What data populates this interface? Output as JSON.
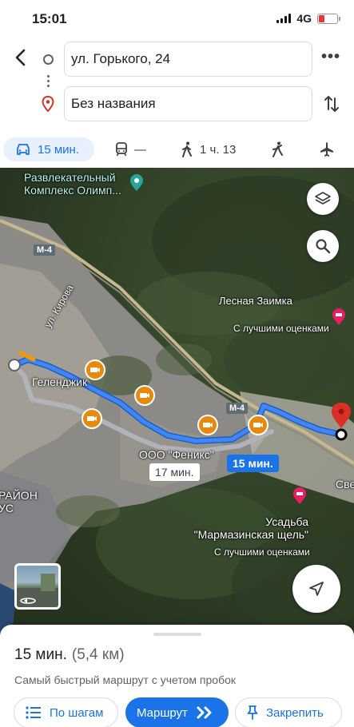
{
  "status_bar": {
    "time": "15:01",
    "network": "4G",
    "battery_color": "#e53935"
  },
  "route_inputs": {
    "back_icon": "back-arrow-icon",
    "origin": "ул. Горького, 24",
    "destination": "Без названия",
    "more_icon": "more-icon",
    "swap_icon": "swap-icon"
  },
  "modes": [
    {
      "icon": "car-icon",
      "label": "15 мин.",
      "active": true
    },
    {
      "icon": "transit-icon",
      "label": "—"
    },
    {
      "icon": "walk-icon",
      "label": "1 ч. 13"
    },
    {
      "icon": "ride-icon",
      "label": ""
    },
    {
      "icon": "flight-icon",
      "label": ""
    }
  ],
  "map": {
    "labels": {
      "entertainment": "Развлекательный\nКомплекс Олимп...",
      "forest": "Лесная Заимка",
      "forest_sub": "С лучшими оценками",
      "street_kirova": "ул. Кирова",
      "gelendzhik": "Геленджик",
      "feniks": "ООО \"Феникс\"",
      "estate": "Усадьба\n\"Мармазинская щель\"",
      "estate_sub": "С лучшими оценками",
      "district": "РАЙОН\nУС",
      "sve": "Све"
    },
    "road_tags": [
      "М-4",
      "М-4"
    ],
    "route_main_time": "15 мин.",
    "route_alt_time": "17 мин.",
    "route_color": "#4285f4",
    "alt_route_color": "#b0b4b8"
  },
  "sheet": {
    "duration": "15 мин.",
    "distance": "(5,4 км)",
    "description": "Самый быстрый маршрут с учетом пробок",
    "buttons": {
      "steps": "По шагам",
      "route": "Маршрут",
      "pin": "Закрепить"
    }
  }
}
